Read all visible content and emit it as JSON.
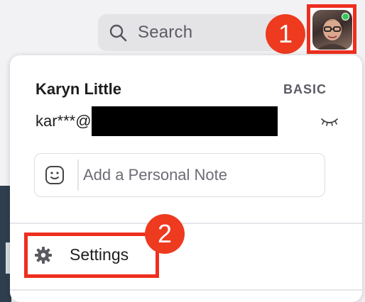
{
  "search": {
    "label": "Search",
    "icon": "search-icon"
  },
  "profile": {
    "avatar_icon": "avatar",
    "status_color": "#34c759",
    "name": "Karyn Little",
    "plan": "BASIC",
    "email_visible": "kar***@",
    "email_redacted": true
  },
  "note": {
    "placeholder": "Add a Personal Note",
    "icon": "smiley-icon"
  },
  "menu": {
    "settings_label": "Settings",
    "settings_icon": "gear-icon"
  },
  "annotations": {
    "callout_1": "1",
    "callout_2": "2",
    "highlight_color": "#ee2f1f"
  }
}
